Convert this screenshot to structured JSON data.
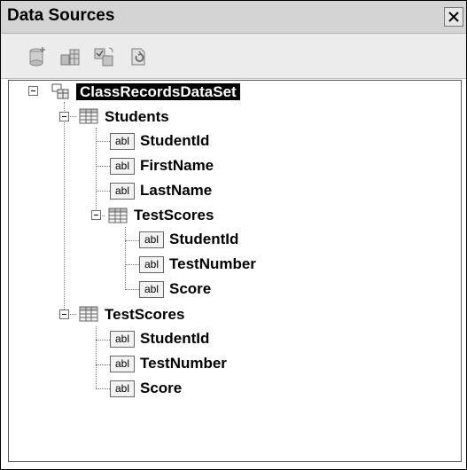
{
  "window": {
    "title": "Data Sources",
    "close_glyph": "✕"
  },
  "toolbar": {
    "buttons": [
      {
        "icon": "add-data-source-icon"
      },
      {
        "icon": "edit-dataset-designer-icon"
      },
      {
        "icon": "configure-dataset-wizard-icon"
      },
      {
        "icon": "refresh-icon"
      }
    ]
  },
  "tree": {
    "root": "ClassRecordsDataSet",
    "students": {
      "label": "Students",
      "fields": [
        "StudentId",
        "FirstName",
        "LastName"
      ],
      "child_table": {
        "label": "TestScores",
        "fields": [
          "StudentId",
          "TestNumber",
          "Score"
        ]
      }
    },
    "testscores": {
      "label": "TestScores",
      "fields": [
        "StudentId",
        "TestNumber",
        "Score"
      ]
    },
    "field_badge": "abl"
  }
}
